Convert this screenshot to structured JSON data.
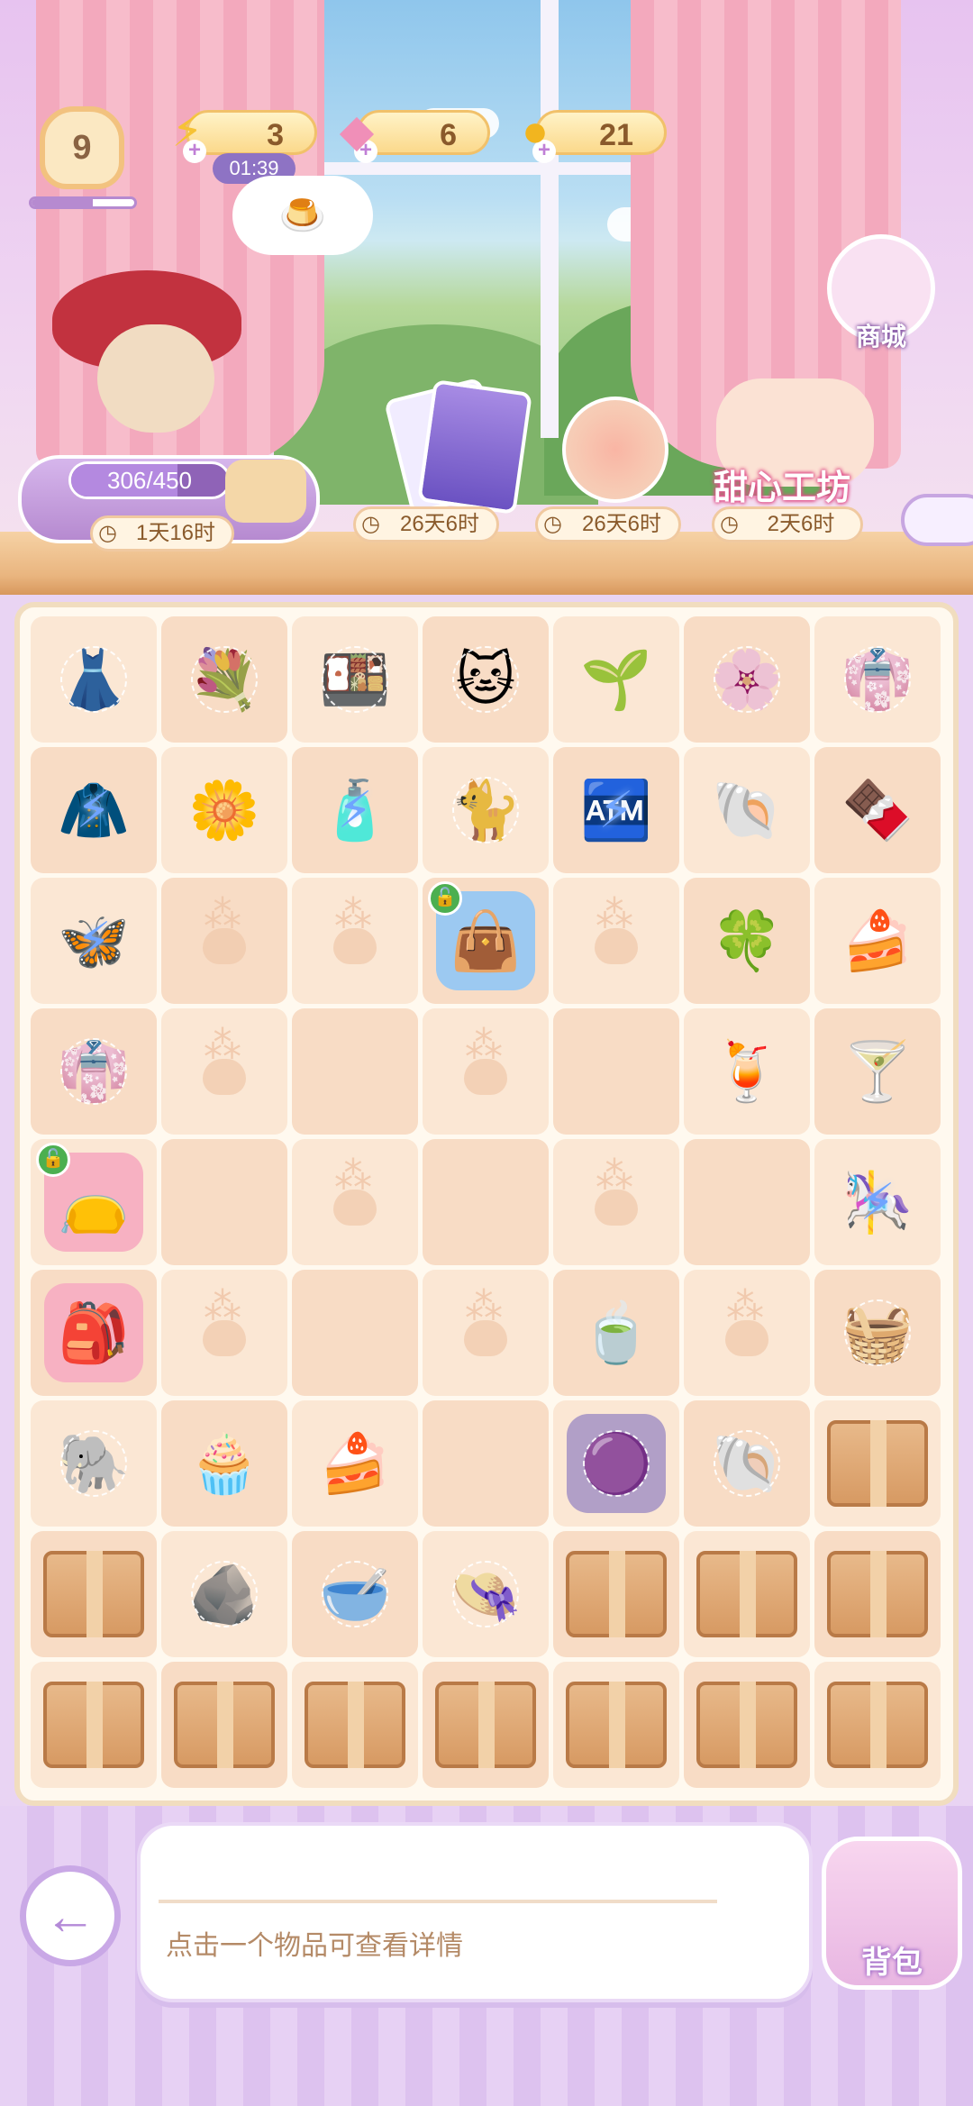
{
  "header": {
    "level": "9",
    "xp_fraction": 0.6,
    "energy": {
      "value": "3",
      "timer": "01:39",
      "icon": "lightning-icon"
    },
    "gems": {
      "value": "6",
      "icon": "gem-icon"
    },
    "coins": {
      "value": "21",
      "icon": "coin-icon"
    },
    "thought_bubble_icon": "pudding-icon",
    "shop_label": "商城"
  },
  "events": {
    "order_progress": {
      "text": "306/450",
      "fraction": 0.68,
      "timer": "1天16时"
    },
    "card_event": {
      "timer": "26天6时"
    },
    "cake_event": {
      "timer": "26天6时"
    },
    "sweet_shop": {
      "title": "甜心工坊",
      "timer": "2天6时"
    }
  },
  "board": {
    "cells": [
      [
        "dress-webbed",
        "bouquet-webbed",
        "dessert-box-webbed",
        "cat-calico-webbed",
        "sprout",
        "flowers-purple-webbed",
        "clothes-rack-webbed"
      ],
      [
        "hanger-energy",
        "bouquet-yellow",
        "perfume-energy",
        "cat-gray-webbed",
        "vending-energy",
        "pearl-shell",
        "chocolate-bowl"
      ],
      [
        "butterfly-energy",
        "paw",
        "paw",
        "bag-blue-locked",
        "paw",
        "clover",
        "strawberry-tart"
      ],
      [
        "gown-webbed",
        "paw",
        "empty",
        "paw",
        "empty",
        "strawberry-drink",
        "glass-cup"
      ],
      [
        "bag-pink-locked",
        "empty",
        "paw",
        "empty",
        "paw",
        "empty",
        "swing-energy"
      ],
      [
        "cat-backpack",
        "paw",
        "empty",
        "paw",
        "tea-cup",
        "paw",
        "fruit-basket-webbed"
      ],
      [
        "elephant-webbed",
        "cream-puff",
        "matcha-cake",
        "empty",
        "purple-blob-webbed",
        "shell-webbed",
        "box"
      ],
      [
        "box",
        "rock-webbed",
        "bowl-webbed",
        "hat-webbed",
        "box",
        "box",
        "box"
      ],
      [
        "box",
        "box",
        "box",
        "box",
        "box",
        "box",
        "box"
      ]
    ]
  },
  "footer": {
    "back_icon": "arrow-left-icon",
    "info_text": "点击一个物品可查看详情",
    "bag_label": "背包"
  }
}
